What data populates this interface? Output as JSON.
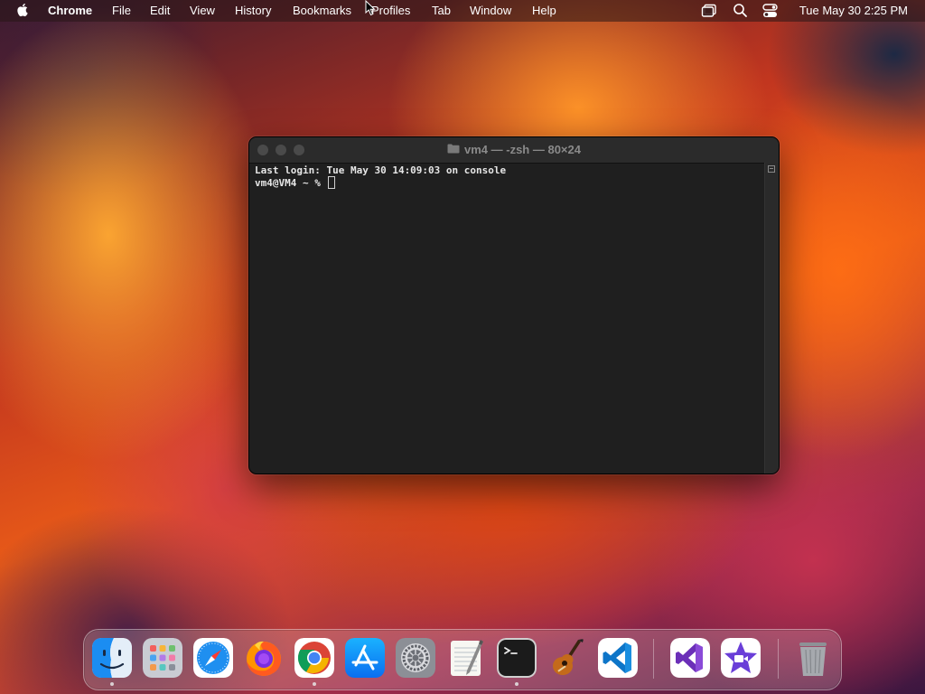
{
  "menubar": {
    "app_name": "Chrome",
    "menus": [
      "File",
      "Edit",
      "View",
      "History",
      "Bookmarks",
      "Profiles",
      "Tab",
      "Window",
      "Help"
    ],
    "clock": "Tue May 30  2:25 PM",
    "status_icons": [
      "screen-mirroring-icon",
      "spotlight-search-icon",
      "control-center-icon"
    ]
  },
  "terminal": {
    "title": "vm4 — -zsh — 80×24",
    "lines": [
      "Last login: Tue May 30 14:09:03 on console",
      "vm4@VM4 ~ % "
    ],
    "traffic_light_color": "#4a4a4a",
    "background": "#1f1f1f"
  },
  "dock": {
    "apps": [
      {
        "name": "Finder",
        "icon": "finder-icon",
        "running": true
      },
      {
        "name": "Launchpad",
        "icon": "launchpad-icon",
        "running": false
      },
      {
        "name": "Safari",
        "icon": "safari-icon",
        "running": false
      },
      {
        "name": "Firefox",
        "icon": "firefox-icon",
        "running": false
      },
      {
        "name": "Google Chrome",
        "icon": "chrome-icon",
        "running": true
      },
      {
        "name": "App Store",
        "icon": "app-store-icon",
        "running": false
      },
      {
        "name": "System Settings",
        "icon": "system-settings-icon",
        "running": false
      },
      {
        "name": "TextEdit",
        "icon": "textedit-icon",
        "running": false
      },
      {
        "name": "Terminal",
        "icon": "terminal-icon",
        "running": true
      },
      {
        "name": "GarageBand",
        "icon": "garageband-icon",
        "running": false
      },
      {
        "name": "Visual Studio Code",
        "icon": "vscode-icon",
        "running": false
      },
      {
        "name": "Visual Studio",
        "icon": "visual-studio-icon",
        "running": false
      },
      {
        "name": "iMovie",
        "icon": "imovie-icon",
        "running": false
      },
      {
        "name": "Trash",
        "icon": "trash-icon",
        "running": false
      }
    ]
  }
}
